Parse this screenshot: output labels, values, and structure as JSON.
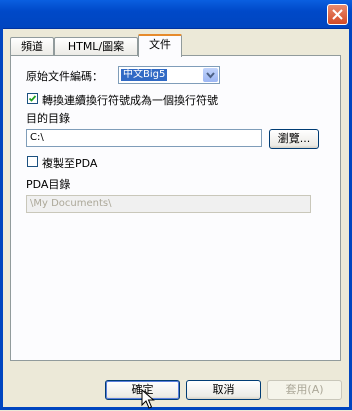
{
  "window": {
    "title": ""
  },
  "tabs": [
    {
      "label": "頻道"
    },
    {
      "label": "HTML/圖案"
    },
    {
      "label": "文件"
    }
  ],
  "document_tab": {
    "encoding_label": "原始文件編碼：",
    "encoding_value": "中文Big5",
    "convert_newlines_label": "轉換連續換行符號成為一個換行符號",
    "convert_newlines_checked": true,
    "destination_label": "目的目錄",
    "destination_value": "C:\\",
    "browse_label": "瀏覽...",
    "copy_pda_label": "複製至PDA",
    "copy_pda_checked": false,
    "pda_dir_label": "PDA目錄",
    "pda_dir_value": "\\My Documents\\"
  },
  "buttons": {
    "ok": "確定",
    "cancel": "取消",
    "apply": "套用(A)"
  },
  "colors": {
    "title_bar": "#0045c0",
    "active_tab_accent": "#e68b2c",
    "selection": "#316ac5"
  }
}
